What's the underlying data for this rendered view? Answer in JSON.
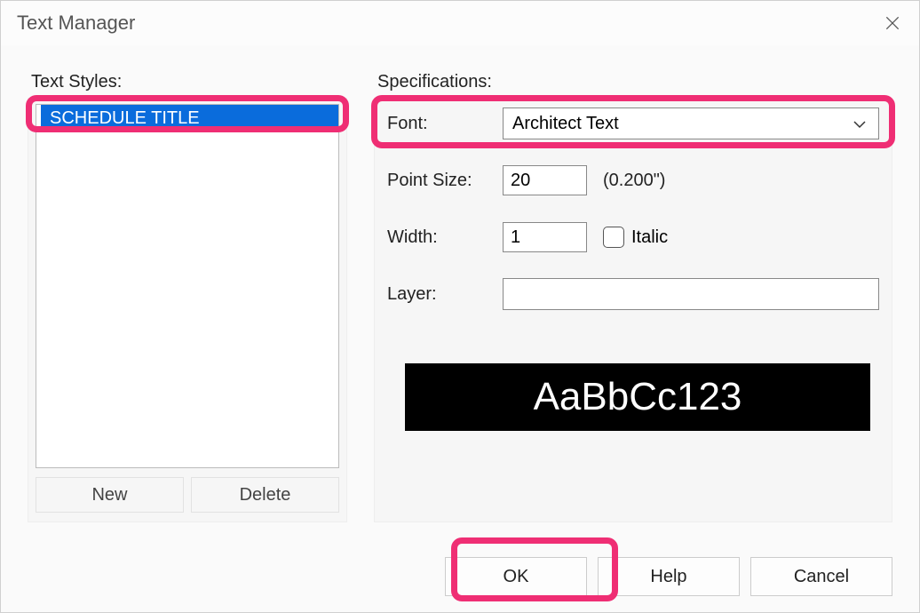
{
  "window": {
    "title": "Text Manager"
  },
  "left": {
    "label": "Text Styles:",
    "items": [
      "SCHEDULE TITLE"
    ],
    "new_label": "New",
    "delete_label": "Delete"
  },
  "right": {
    "label": "Specifications:",
    "font_label": "Font:",
    "font_value": "Architect Text",
    "pointsize_label": "Point Size:",
    "pointsize_value": "20",
    "pointsize_after": "(0.200\")",
    "width_label": "Width:",
    "width_value": "1",
    "italic_label": "Italic",
    "layer_label": "Layer:",
    "preview_text": "AaBbCc123"
  },
  "buttons": {
    "ok": "OK",
    "help": "Help",
    "cancel": "Cancel"
  }
}
